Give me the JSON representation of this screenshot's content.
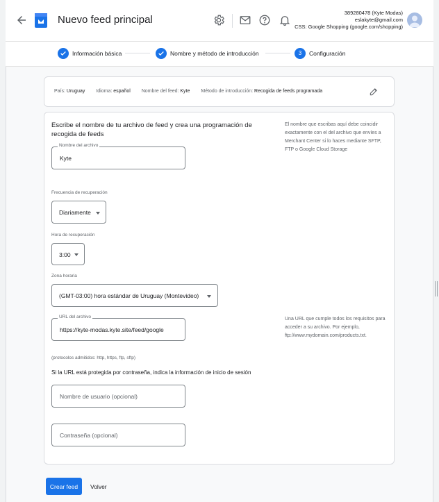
{
  "header": {
    "title": "Nuevo feed principal",
    "account_id": "389280478 (Kyte Modas)",
    "email": "eslakyte@gmail.com",
    "css": "CSS: Google Shopping (google.com/shopping)"
  },
  "stepper": {
    "steps": [
      {
        "label": "Información básica",
        "state": "done"
      },
      {
        "label": "Nombre y método de introducción",
        "state": "done"
      },
      {
        "label": "Configuración",
        "state": "active",
        "number": "3"
      }
    ]
  },
  "summary": {
    "country_label": "País:",
    "country_value": "Uruguay",
    "language_label": "Idioma:",
    "language_value": "español",
    "feedname_label": "Nombre del feed:",
    "feedname_value": "Kyte",
    "method_label": "Método de introducción:",
    "method_value": "Recogida de feeds programada"
  },
  "form": {
    "heading": "Escribe el nombre de tu archivo de feed y crea una programación de recogida de feeds",
    "help_filename": "El nombre que escribas aquí debe coincidir exactamente con el del archivo que envíes a Merchant Center si lo haces mediante SFTP, FTP o Google Cloud Storage",
    "filename_label": "Nombre del archivo",
    "filename_value": "Kyte",
    "frequency_label": "Frecuencia de recuperación",
    "frequency_value": "Diariamente",
    "hour_label": "Hora de recuperación",
    "hour_value": "3:00",
    "timezone_label": "Zona horaria",
    "timezone_value": "(GMT-03:00) hora estándar de Uruguay (Montevideo)",
    "url_label": "URL del archivo",
    "url_value": "https://kyte-modas.kyte.site/feed/google",
    "help_url": "Una URL que cumple todos los requisitos para acceder a su archivo. Por ejemplo, ftp://www.mydomain.com/products.txt.",
    "protocols": "(protocolos admitidos: http, https, ftp, sftp)",
    "password_question": "Si la URL está protegida por contraseña, indica la información de inicio de sesión",
    "username_placeholder": "Nombre de usuario (opcional)",
    "password_placeholder": "Contraseña (opcional)"
  },
  "actions": {
    "create": "Crear feed",
    "back": "Volver"
  },
  "colors": {
    "accent": "#1a73e8",
    "surface": "#ffffff",
    "background": "#f8f9fa"
  },
  "icons": [
    "back-arrow-icon",
    "merchant-center-logo-icon",
    "settings-icon",
    "mail-icon",
    "help-icon",
    "notifications-icon",
    "avatar",
    "check-icon",
    "edit-icon",
    "chevron-down-icon"
  ]
}
